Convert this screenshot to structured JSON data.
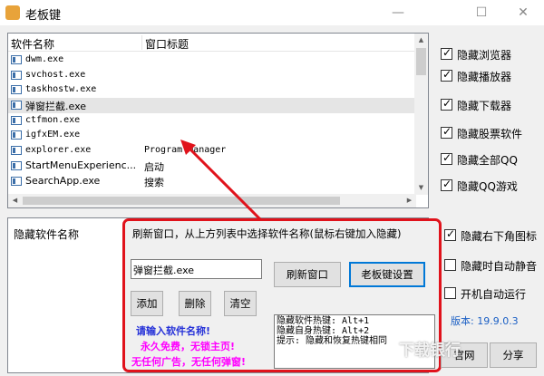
{
  "window": {
    "title": "老板键",
    "controls": [
      "—",
      "☐",
      "✕"
    ]
  },
  "software_list": {
    "columns": [
      "软件名称",
      "窗口标题"
    ],
    "rows": [
      {
        "name": "dwm.exe",
        "title": ""
      },
      {
        "name": "svchost.exe",
        "title": ""
      },
      {
        "name": "taskhostw.exe",
        "title": ""
      },
      {
        "name": "弹窗拦截.exe",
        "title": "",
        "selected": true
      },
      {
        "name": "ctfmon.exe",
        "title": ""
      },
      {
        "name": "igfxEM.exe",
        "title": ""
      },
      {
        "name": "explorer.exe",
        "title": "Program Manager"
      },
      {
        "name": "StartMenuExperienc...",
        "title": "启动"
      },
      {
        "name": "SearchApp.exe",
        "title": "搜索"
      }
    ]
  },
  "options": [
    {
      "label": "隐藏浏览器",
      "checked": true
    },
    {
      "label": "隐藏播放器",
      "checked": true
    },
    {
      "label": "隐藏下载器",
      "checked": true
    },
    {
      "label": "隐藏股票软件",
      "checked": true
    },
    {
      "label": "隐藏全部QQ",
      "checked": true
    },
    {
      "label": "隐藏QQ游戏",
      "checked": true
    },
    {
      "label": "隐藏右下角图标",
      "checked": true
    },
    {
      "label": "隐藏时自动静音",
      "checked": false
    },
    {
      "label": "开机自动运行",
      "checked": false
    }
  ],
  "hidden_list": {
    "header": "隐藏软件名称"
  },
  "callout": {
    "hint": "刷新窗口，从上方列表中选择软件名称(鼠标右键加入隐藏)",
    "input_value": "弹窗拦截.exe",
    "refresh_button": "刷新窗口",
    "settings_button": "老板键设置",
    "add_button": "添加",
    "delete_button": "删除",
    "clear_button": "清空",
    "prompt": "请输入软件名称!",
    "promo1": "永久免费，无锁主页!",
    "promo2": "无任何广告，无任何弹窗!",
    "hotkeys": [
      "隐藏软件热键: Alt+1",
      "隐藏自身热键: Alt+2",
      "提示: 隐藏和恢复热键相同"
    ]
  },
  "version": "版本: 19.9.0.3",
  "bottom": {
    "website": "官网",
    "share": "分享"
  },
  "watermark": "下载银行",
  "colors": {
    "callout_border": "#e0121b",
    "version_text": "#1a5fc4",
    "promo": "#ff00ff",
    "prompt": "#2430d8"
  }
}
